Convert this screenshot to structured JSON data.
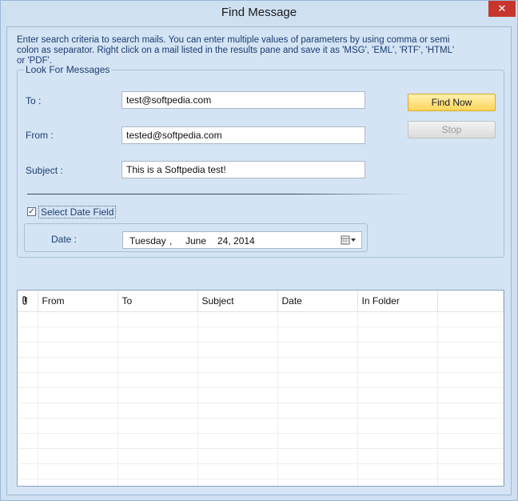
{
  "window": {
    "title": "Find Message",
    "close_glyph": "✕"
  },
  "description": "Enter search criteria to search mails. You can enter multiple values of parameters by using comma or semi colon as separator. Right click on a mail listed in the results pane and save it as 'MSG', 'EML', 'RTF', 'HTML' or 'PDF'.",
  "look_for": {
    "legend": "Look For Messages",
    "to_label": "To :",
    "to_value": "test@softpedia.com",
    "from_label": "From :",
    "from_value": "tested@softpedia.com",
    "subject_label": "Subject :",
    "subject_value": "This is a Softpedia test!",
    "find_now": "Find Now",
    "stop": "Stop",
    "select_date_label": "Select Date Field",
    "select_date_checked": "✓",
    "date_label": "Date :",
    "date_weekday": "Tuesday",
    "date_sep": ",",
    "date_month": "June",
    "date_day_year": "24, 2014"
  },
  "results": {
    "attachment_icon": "attachment-icon",
    "columns": [
      "From",
      "To",
      "Subject",
      "Date",
      "In Folder"
    ]
  }
}
